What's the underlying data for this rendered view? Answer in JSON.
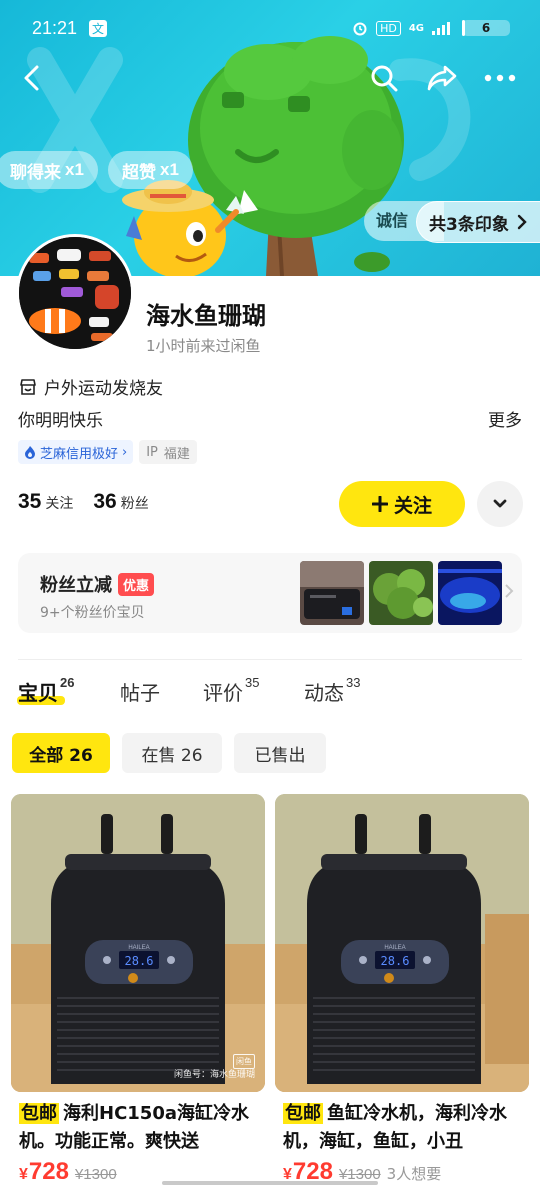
{
  "status_bar": {
    "time": "21:21",
    "app_badge": "文",
    "hd": "HD",
    "network": "4G",
    "battery": "6",
    "battery_level": 0.06
  },
  "header": {
    "badges": [
      {
        "label": "聊得来",
        "count": "x1"
      },
      {
        "label": "超赞",
        "count": "x1"
      }
    ],
    "impression_partial": "诚信",
    "impression_label": "共3条印象"
  },
  "profile": {
    "name": "海水鱼珊瑚",
    "last_seen": "1小时前来过闲鱼",
    "tag": "户外运动发烧友",
    "bio": "你明明快乐",
    "more": "更多",
    "credit": "芝麻信用极好",
    "ip_label": "IP",
    "ip_location": "福建"
  },
  "stats": {
    "following_count": "35",
    "following_label": "关注",
    "fans_count": "36",
    "fans_label": "粉丝"
  },
  "follow_button": {
    "label": "关注"
  },
  "promo": {
    "title": "粉丝立减",
    "tag": "优惠",
    "subtitle": "9+个粉丝价宝贝"
  },
  "tabs": [
    {
      "label": "宝贝",
      "count": "26"
    },
    {
      "label": "帖子",
      "count": ""
    },
    {
      "label": "评价",
      "count": "35"
    },
    {
      "label": "动态",
      "count": "33"
    }
  ],
  "filters": [
    {
      "label": "全部 26"
    },
    {
      "label": "在售 26"
    },
    {
      "label": "已售出"
    }
  ],
  "products": [
    {
      "ship_tag": "包邮",
      "title": "海利HC150a海缸冷水机。功能正常。爽快送",
      "currency": "¥",
      "price": "728",
      "original_price": "¥1300",
      "wants": "",
      "display": "28.6",
      "brand": "HAILEA",
      "watermark_box": "闲鱼",
      "watermark_text": "闲鱼号：海水鱼珊瑚"
    },
    {
      "ship_tag": "包邮",
      "title": "鱼缸冷水机，海利冷水机，海缸，鱼缸，小丑",
      "currency": "¥",
      "price": "728",
      "original_price": "¥1300",
      "wants": "3人想要",
      "display": "28.6",
      "brand": "HAILEA",
      "watermark_box": "",
      "watermark_text": ""
    }
  ],
  "colors": {
    "accent_yellow": "#ffe60f",
    "price_red": "#ff3b30",
    "banner_cyan": "#1fb8d8",
    "promo_red": "#ff4d4f"
  }
}
